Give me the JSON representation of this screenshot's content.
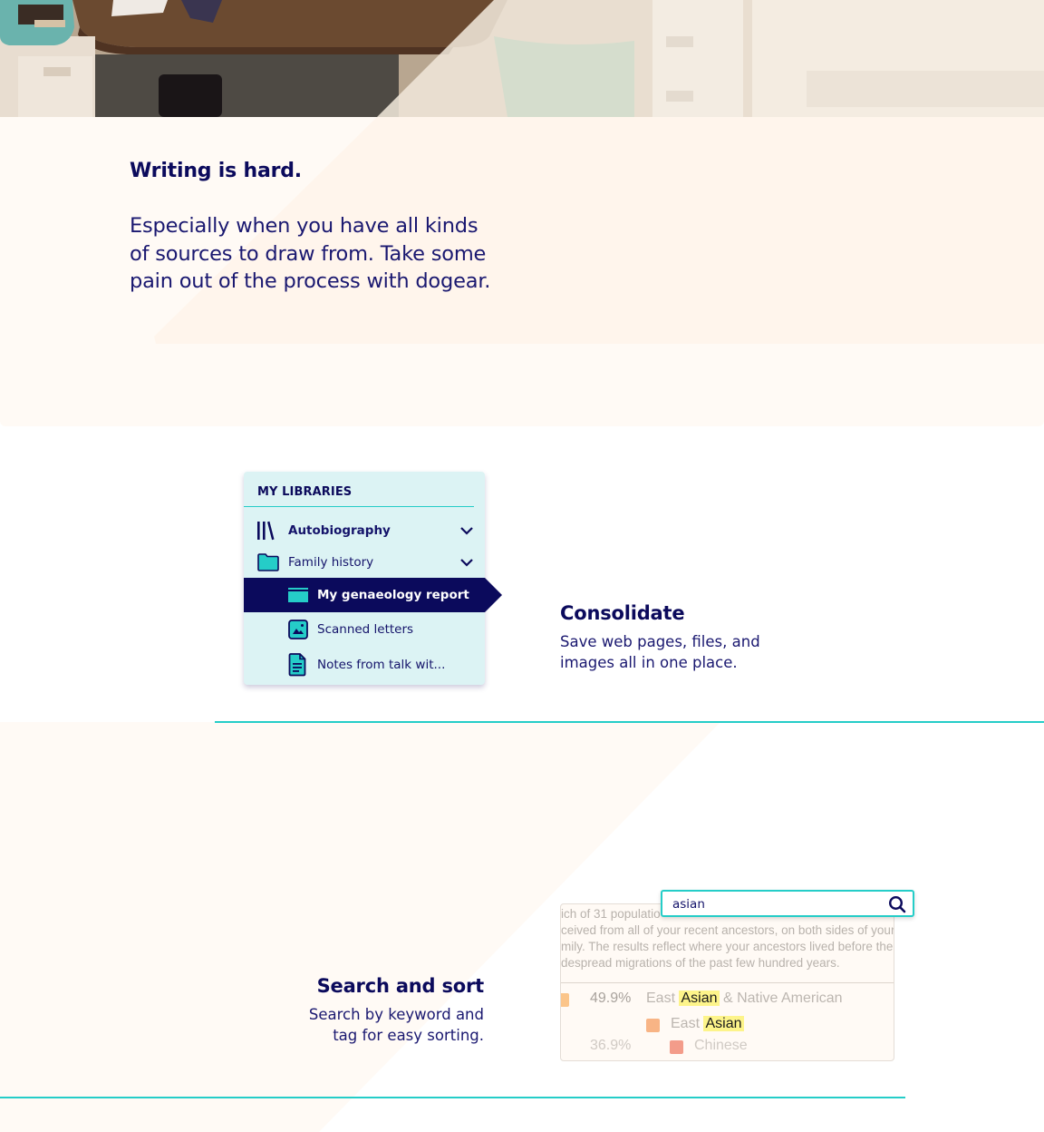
{
  "hero": {
    "image_alt": "desk-with-typewriter-photo"
  },
  "intro": {
    "heading": "Writing is hard.",
    "body_lines": [
      "Especially when you have all kinds",
      "of sources to draw from. Take some",
      "pain out of the process with dogear."
    ]
  },
  "libraries": {
    "title": "MY LIBRARIES",
    "items": [
      {
        "label": "Autobiography",
        "icon": "library-books-icon",
        "expandable": true,
        "level": 0,
        "bold": true
      },
      {
        "label": "Family history",
        "icon": "folder-icon",
        "expandable": true,
        "level": 0
      },
      {
        "label": "My genaeology report",
        "icon": "web-page-icon",
        "active": true,
        "level": 1
      },
      {
        "label": "Scanned letters",
        "icon": "image-file-icon",
        "level": 1
      },
      {
        "label": "Notes from talk wit...",
        "icon": "document-icon",
        "level": 1
      }
    ]
  },
  "consolidate": {
    "heading": "Consolidate",
    "body_lines": [
      "Save web pages, files, and",
      "images all in one place."
    ]
  },
  "search_sort": {
    "heading": "Search and sort",
    "body_lines": [
      "Search by keyword and",
      "tag for easy sorting."
    ]
  },
  "search": {
    "value": "asian",
    "icon": "search-icon"
  },
  "document_preview": {
    "text_lines": [
      "ich of 31 populatio",
      "ceived from all of your recent ancestors, on both sides of your",
      "mily. The results reflect where your ancestors lived before the",
      "despread migrations of the past few hundred years."
    ],
    "rows": [
      {
        "percent": "49.9%",
        "pre": "East ",
        "match": "Asian",
        "post": " & Native American",
        "color": "#fbc58a"
      },
      {
        "percent": "",
        "pre": "East ",
        "match": "Asian",
        "post": "",
        "color": "#f8b485"
      },
      {
        "percent": "36.9%",
        "pre": "",
        "match": "",
        "post": "Chinese",
        "color": "#f39c8a"
      }
    ]
  },
  "colors": {
    "navy": "#0b0a5c",
    "teal": "#25cdc8",
    "panel_bg": "#dcf3f4",
    "cream": "#fffaf5",
    "highlight": "#fdf48a"
  }
}
